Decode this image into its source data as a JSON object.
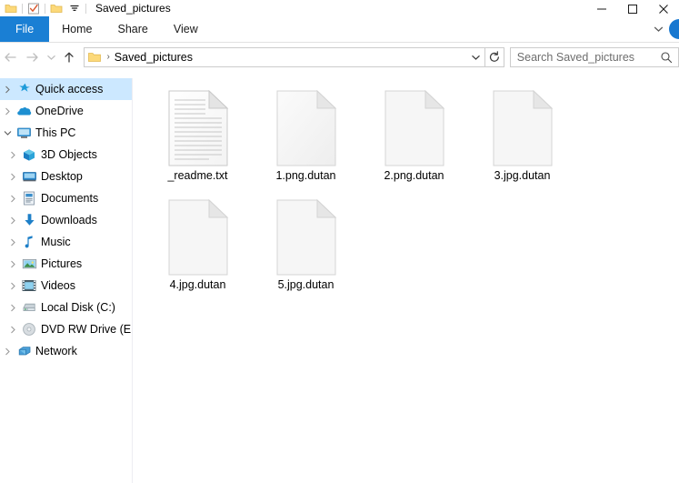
{
  "window": {
    "title": "Saved_pictures",
    "quick_access_toolbar": [
      {
        "name": "folder-icon",
        "label": "Properties"
      },
      {
        "name": "checkbox-icon",
        "label": "New folder"
      },
      {
        "name": "folder-icon",
        "label": "Folder"
      },
      {
        "name": "chevron-down-icon",
        "label": "Customize Quick Access Toolbar"
      }
    ],
    "controls": {
      "minimize": "—",
      "maximize": "□",
      "close": "✕"
    }
  },
  "ribbon": {
    "tabs": [
      {
        "label": "File",
        "selected": true
      },
      {
        "label": "Home",
        "selected": false
      },
      {
        "label": "Share",
        "selected": false
      },
      {
        "label": "View",
        "selected": false
      }
    ],
    "expand_icon": "chevron-down-icon",
    "help_icon": "help-circle-icon",
    "file_tab_color": "#1a7fd4"
  },
  "addressbar": {
    "back_label": "Back",
    "forward_label": "Forward",
    "recent_label": "Recent locations",
    "up_label": "Up",
    "breadcrumb_separator": "›",
    "path_text": "Saved_pictures",
    "dropdown_icon": "chevron-down-icon",
    "refresh_icon": "refresh-icon",
    "search_placeholder": "Search Saved_pictures",
    "search_value": "",
    "search_icon": "search-icon"
  },
  "sidebar": {
    "selected_color": "#cce8ff",
    "items": [
      {
        "label": "Quick access",
        "icon": "star-icon",
        "level": 1,
        "expander": "chevron-right-icon",
        "selected": true
      },
      {
        "label": "OneDrive",
        "icon": "cloud-icon",
        "level": 1,
        "expander": "chevron-right-icon",
        "selected": false
      },
      {
        "label": "This PC",
        "icon": "monitor-icon",
        "level": 1,
        "expander": "chevron-down-icon",
        "selected": false
      },
      {
        "label": "3D Objects",
        "icon": "cube-icon",
        "level": 2,
        "expander": "chevron-right-icon",
        "selected": false
      },
      {
        "label": "Desktop",
        "icon": "desktop-icon",
        "level": 2,
        "expander": "chevron-right-icon",
        "selected": false
      },
      {
        "label": "Documents",
        "icon": "document-icon",
        "level": 2,
        "expander": "chevron-right-icon",
        "selected": false
      },
      {
        "label": "Downloads",
        "icon": "download-arrow-icon",
        "level": 2,
        "expander": "chevron-right-icon",
        "selected": false
      },
      {
        "label": "Music",
        "icon": "music-note-icon",
        "level": 2,
        "expander": "chevron-right-icon",
        "selected": false
      },
      {
        "label": "Pictures",
        "icon": "picture-icon",
        "level": 2,
        "expander": "chevron-right-icon",
        "selected": false
      },
      {
        "label": "Videos",
        "icon": "video-icon",
        "level": 2,
        "expander": "chevron-right-icon",
        "selected": false
      },
      {
        "label": "Local Disk (C:)",
        "icon": "hard-drive-icon",
        "level": 2,
        "expander": "chevron-right-icon",
        "selected": false
      },
      {
        "label": "DVD RW Drive (E:) N",
        "icon": "disc-drive-icon",
        "level": 2,
        "expander": "chevron-right-icon",
        "selected": false
      },
      {
        "label": "Network",
        "icon": "network-icon",
        "level": 1,
        "expander": "chevron-right-icon",
        "selected": false
      }
    ]
  },
  "files": [
    {
      "name": "_readme.txt",
      "icon": "text-file-icon"
    },
    {
      "name": "1.png.dutan",
      "icon": "generic-file-icon"
    },
    {
      "name": "2.png.dutan",
      "icon": "generic-file-icon"
    },
    {
      "name": "3.jpg.dutan",
      "icon": "generic-file-icon"
    },
    {
      "name": "4.jpg.dutan",
      "icon": "generic-file-icon"
    },
    {
      "name": "5.jpg.dutan",
      "icon": "generic-file-icon"
    }
  ]
}
